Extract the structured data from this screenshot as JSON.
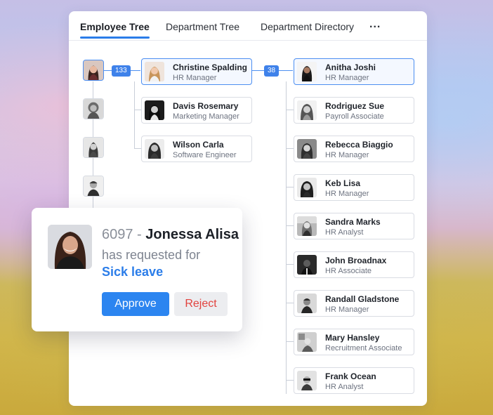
{
  "tabs": [
    {
      "label": "Employee Tree",
      "active": true
    },
    {
      "label": "Department Tree",
      "active": false
    },
    {
      "label": "Department Directory",
      "active": false
    }
  ],
  "more_label": "...",
  "badges": {
    "first": "133",
    "second": "38"
  },
  "level2": [
    {
      "name": "Christine Spalding",
      "role": "HR Manager"
    },
    {
      "name": "Davis Rosemary",
      "role": "Marketing Manager"
    },
    {
      "name": "Wilson Carla",
      "role": "Software Engineer"
    }
  ],
  "level3": [
    {
      "name": "Anitha Joshi",
      "role": "HR Manager"
    },
    {
      "name": "Rodriguez Sue",
      "role": "Payroll Associate"
    },
    {
      "name": "Rebecca Biaggio",
      "role": "HR Manager"
    },
    {
      "name": "Keb Lisa",
      "role": "HR Manager"
    },
    {
      "name": "Sandra Marks",
      "role": "HR Analyst"
    },
    {
      "name": "John Broadnax",
      "role": "HR Associate"
    },
    {
      "name": "Randall Gladstone",
      "role": "HR Manager"
    },
    {
      "name": "Mary Hansley",
      "role": "Recruitment Associate"
    },
    {
      "name": "Frank Ocean",
      "role": "HR Analyst"
    }
  ],
  "popup": {
    "employee_id": "6097",
    "separator": " - ",
    "employee_name": "Jonessa Alisa",
    "message": "has requested for",
    "leave_type": "Sick leave",
    "approve_label": "Approve",
    "reject_label": "Reject"
  },
  "colors": {
    "accent": "#2c85f0",
    "reject": "#e2423e",
    "connector": "#4d8ff1"
  }
}
